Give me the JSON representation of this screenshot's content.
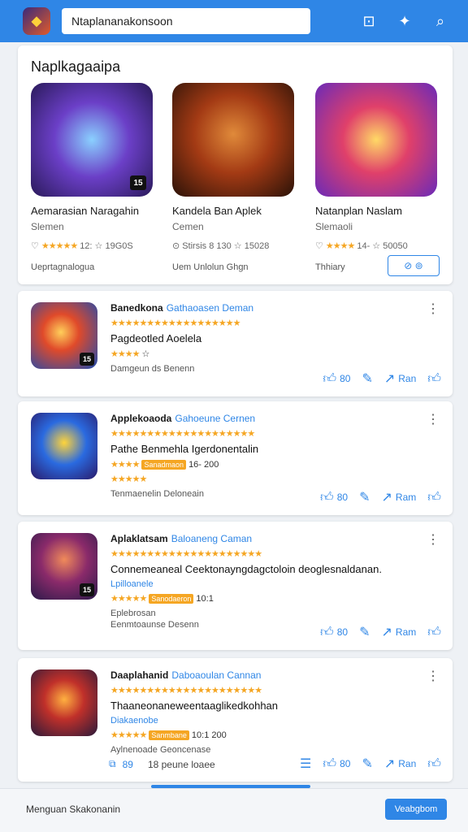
{
  "header": {
    "search_value": "Ntaplananakonsoon",
    "accent": "#2f86e6"
  },
  "featured": {
    "title": "Naplkagaaipa",
    "items": [
      {
        "name": "Aemarasian Naragahin",
        "sub": "Slemen",
        "rating_text": "12: ☆ 19G0S",
        "dev": "Ueprtagnalogua",
        "badge": "15"
      },
      {
        "name": "Kandela Ban Aplek",
        "sub": "Cemen",
        "rating_text": "Stirsis 8 130 ☆ 15028",
        "dev": "Uem Unlolun Ghgn",
        "badge": ""
      },
      {
        "name": "Natanplan Naslam",
        "sub": "Slemaoli",
        "rating_text": "14- ☆ 50050",
        "dev": "Thhiary",
        "badge": ""
      }
    ],
    "install_label": "⊘ ⊚"
  },
  "list": [
    {
      "name": "Banedkona",
      "category": "Gathaoasen Deman",
      "line1": "Pagdeotled Aoelela",
      "rating_extra": "☆",
      "muted": "Damgeun ds Benenn",
      "badge": "15",
      "actions": [
        "80",
        "",
        "Ran",
        ""
      ]
    },
    {
      "name": "Applekoaoda",
      "category": "Gahoeune Cernen",
      "line1": "Pathe Benmehla Igerdonentalin",
      "rating_extra": "16- 200",
      "tag": "Sanadmaon",
      "muted": "Tenmaenelin Deloneain",
      "badge": "",
      "actions": [
        "80",
        "",
        "Ram",
        ""
      ]
    },
    {
      "name": "Aplaklatsam",
      "category": "Baloaneng Caman",
      "line1": "Connemeaneal Ceektonayngdagctoloin deoglesnaldanan.",
      "line2": "Lpilloanele",
      "rating_extra": "10:1",
      "tag": "Sanodaeron",
      "muted": "Eplebrosan",
      "muted2": "Eenmtoaunse Desenn",
      "badge": "15",
      "actions": [
        "80",
        "",
        "Ram",
        ""
      ]
    },
    {
      "name": "Daaplahanid",
      "category": "Daboaoulan Cannan",
      "line1": "Thaaneonaneweentaaglikedkohhan",
      "line2": "Diakaenobe",
      "rating_extra": "10:1 200",
      "tag": "Sanmbane",
      "muted": "Aylnenoade Geoncenase",
      "footer_text": "18 peune loaee",
      "footer_num": "89",
      "badge": "",
      "actions": [
        "80",
        "",
        "Ran",
        ""
      ]
    }
  ],
  "bottom": {
    "text": "Menguan Skakonanin",
    "button_label": "Veabgbom"
  }
}
